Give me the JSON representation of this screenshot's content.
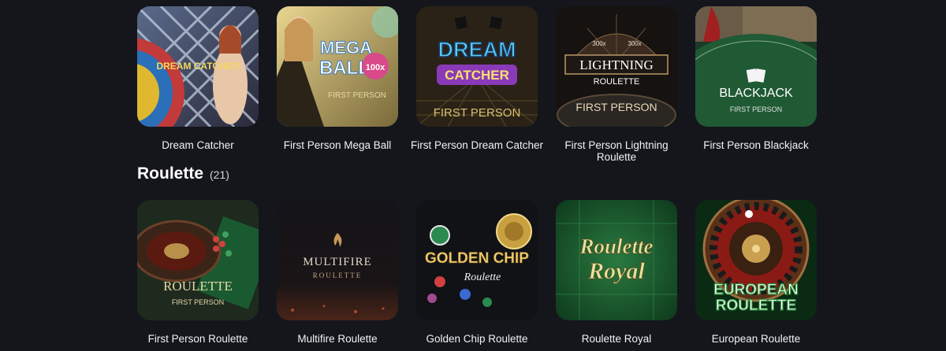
{
  "top_games": [
    {
      "title": "Dream Catcher",
      "art_text": [
        "DREAM CATCHER"
      ]
    },
    {
      "title": "First Person Mega Ball",
      "art_text": [
        "MEGA",
        "BALL",
        "100x",
        "FIRST PERSON"
      ]
    },
    {
      "title": "First Person Dream Catcher",
      "art_text": [
        "DREAM",
        "CATCHER",
        "FIRST PERSON"
      ]
    },
    {
      "title": "First Person Lightning Roulette",
      "art_text": [
        "300x",
        "300x",
        "LIGHTNING",
        "ROULETTE",
        "FIRST PERSON"
      ]
    },
    {
      "title": "First Person Blackjack",
      "art_text": [
        "BLACKJACK",
        "FIRST PERSON"
      ]
    }
  ],
  "section": {
    "title": "Roulette",
    "count": "(21)"
  },
  "roulette_games": [
    {
      "title": "First Person Roulette",
      "art_text": [
        "ROULETTE",
        "FIRST PERSON"
      ]
    },
    {
      "title": "Multifire Roulette",
      "art_text": [
        "MULTIFIRE",
        "ROULETTE"
      ]
    },
    {
      "title": "Golden Chip Roulette",
      "art_text": [
        "GOLDEN CHIP",
        "Roulette"
      ]
    },
    {
      "title": "Roulette Royal",
      "art_text": [
        "Roulette",
        "Royal"
      ]
    },
    {
      "title": "European Roulette",
      "art_text": [
        "EUROPEAN",
        "ROULETTE"
      ]
    }
  ]
}
